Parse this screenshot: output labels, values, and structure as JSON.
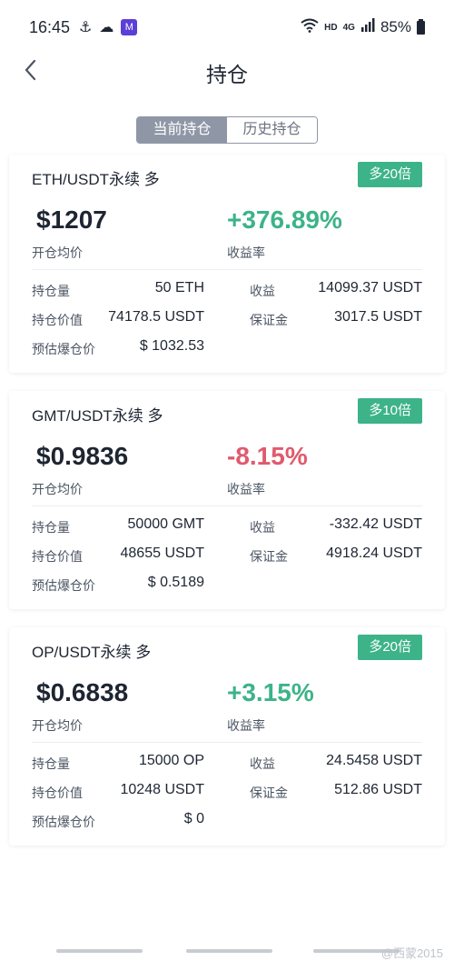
{
  "status_bar": {
    "time": "16:45",
    "icons": [
      "ship-icon",
      "weather-icon",
      "app-icon"
    ],
    "app_letter": "M",
    "network": "HD",
    "signal": "4G",
    "battery": "85%"
  },
  "header": {
    "title": "持仓",
    "back_icon": "chevron-left-icon"
  },
  "tabs": [
    {
      "label": "当前持仓",
      "active": true
    },
    {
      "label": "历史持仓",
      "active": false
    }
  ],
  "labels": {
    "open_price": "开仓均价",
    "return_rate": "收益率",
    "position_size": "持仓量",
    "position_value": "持仓价值",
    "est_liquidation": "预估爆仓价",
    "profit": "收益",
    "margin": "保证金"
  },
  "positions": [
    {
      "pair": "ETH/USDT永续 多",
      "leverage": "多20倍",
      "open_price": "$1207",
      "return_rate": "+376.89%",
      "direction": "positive",
      "position_size": "50 ETH",
      "position_value": "74178.5 USDT",
      "est_liquidation": "$ 1032.53",
      "profit": "14099.37 USDT",
      "margin": "3017.5 USDT"
    },
    {
      "pair": "GMT/USDT永续 多",
      "leverage": "多10倍",
      "open_price": "$0.9836",
      "return_rate": "-8.15%",
      "direction": "negative",
      "position_size": "50000 GMT",
      "position_value": "48655 USDT",
      "est_liquidation": "$ 0.5189",
      "profit": "-332.42 USDT",
      "margin": "4918.24 USDT"
    },
    {
      "pair": "OP/USDT永续 多",
      "leverage": "多20倍",
      "open_price": "$0.6838",
      "return_rate": "+3.15%",
      "direction": "positive",
      "position_size": "15000 OP",
      "position_value": "10248 USDT",
      "est_liquidation": "$ 0",
      "profit": "24.5458 USDT",
      "margin": "512.86 USDT"
    }
  ],
  "watermark": "@西蒙2015",
  "colors": {
    "accent_green": "#3db389",
    "loss_red": "#e05a6d",
    "tab_active": "#8f97a6"
  }
}
